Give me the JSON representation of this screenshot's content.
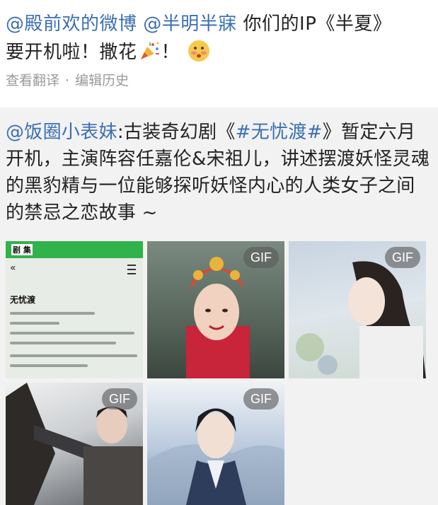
{
  "post": {
    "mention1": "@殿前欢的微博",
    "mention2": "@半明半寐",
    "text_a": " 你们的IP《半夏》",
    "text_b": "要开机啦！撒花",
    "text_c": "！",
    "meta_translate": "查看翻译",
    "meta_dot": "·",
    "meta_history": "编辑历史"
  },
  "repost": {
    "mention": "@饭圈小表妹",
    "text_a": ":古装奇幻剧《",
    "hashtag": "#无忧渡#",
    "text_b": "》暂定六月开机，主演阵容任嘉伦&宋祖儿，讲述摆渡妖怪灵魂的黑豹精与一位能够探听妖怪内心的人类女子之间的禁忌之恋故事 ~"
  },
  "images": {
    "gif_label": "GIF",
    "screenshot": {
      "header": "剧 集",
      "back": "«",
      "title": "无忧渡"
    }
  },
  "icons": [
    "party-popper-icon",
    "blushing-face-icon",
    "back-chevron-icon",
    "menu-icon"
  ]
}
